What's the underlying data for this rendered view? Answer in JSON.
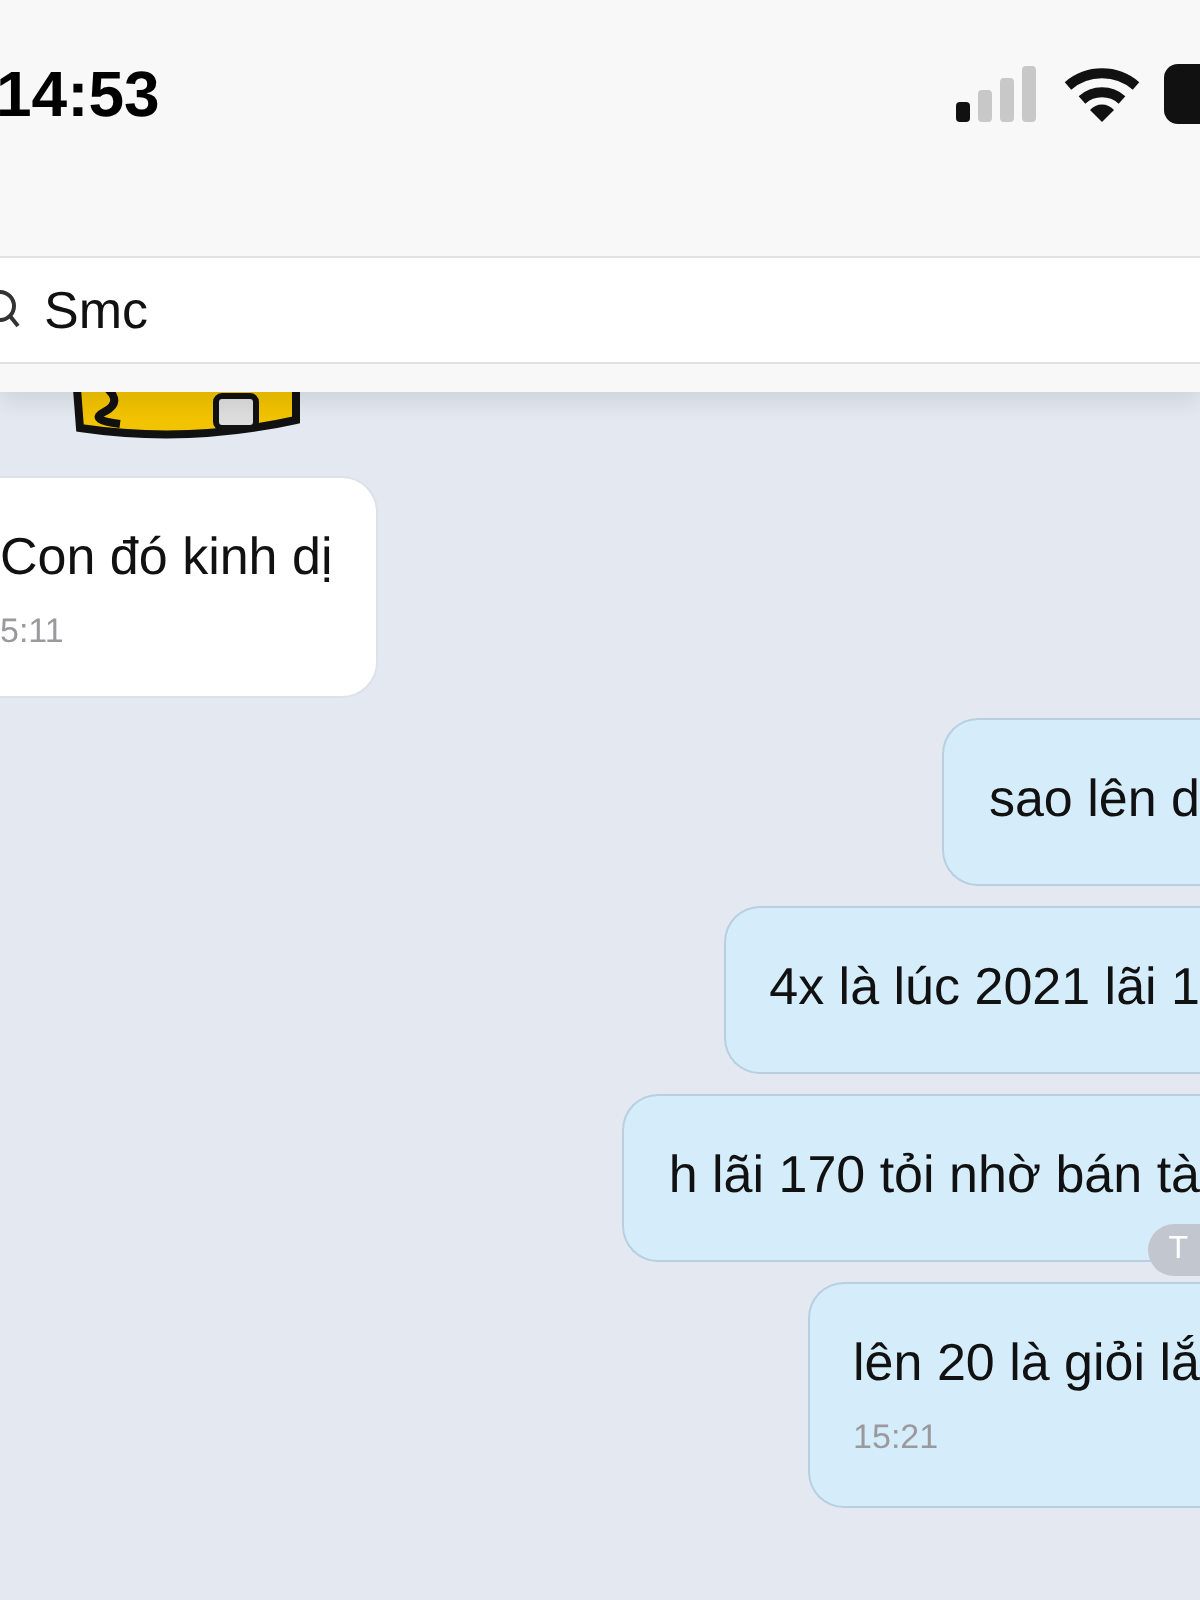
{
  "status_bar": {
    "time": "14:53"
  },
  "search": {
    "value": "Smc"
  },
  "messages": [
    {
      "kind": "sticker"
    },
    {
      "kind": "incoming",
      "text": "Con đó kinh dị",
      "time": "5:11"
    },
    {
      "kind": "outgoing",
      "text": "sao lên d"
    },
    {
      "kind": "outgoing",
      "text": "4x là lúc 2021 lãi 1"
    },
    {
      "kind": "outgoing",
      "text": "h lãi 170 tỏi nhờ bán tà",
      "badge": "T"
    },
    {
      "kind": "outgoing",
      "text": "lên 20 là giỏi lắ",
      "time": "15:21"
    }
  ]
}
